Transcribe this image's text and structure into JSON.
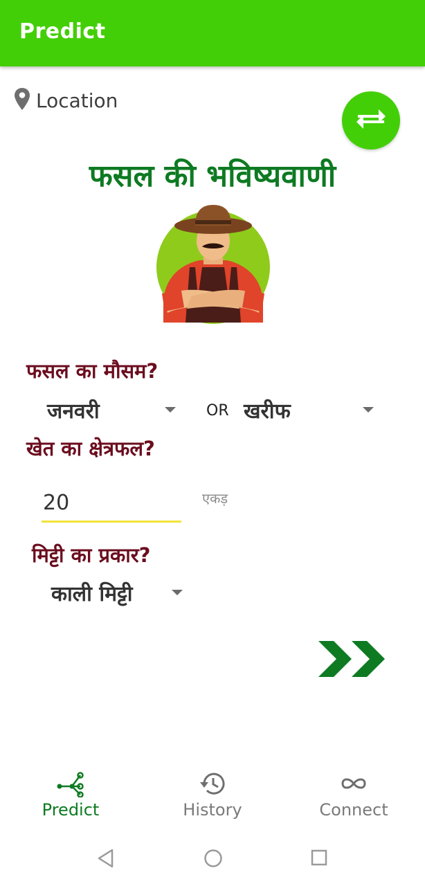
{
  "appbar": {
    "title": "Predict",
    "color": "#43cf07"
  },
  "location": {
    "label": "Location",
    "icon": "map-pin-icon"
  },
  "swap_button": {
    "icon": "swap-arrows-icon"
  },
  "page_title": "फसल की भविष्यवाणी",
  "illustration": {
    "name": "farmer-illustration"
  },
  "season": {
    "question": "फसल का मौसम?",
    "month_value": "जनवरी",
    "or_text": "OR",
    "season_value": "खरीफ"
  },
  "area": {
    "question": "खेत का क्षेत्रफल?",
    "value": "20",
    "unit": "एकड़"
  },
  "soil": {
    "question": "मिट्टी का प्रकार?",
    "value": "काली मिट्टी"
  },
  "next_button": {
    "icon": "double-chevron-right-icon",
    "color": "#0e7a22"
  },
  "bottom_nav": {
    "items": [
      {
        "label": "Predict",
        "icon": "share-nodes-icon",
        "active": true
      },
      {
        "label": "History",
        "icon": "history-icon",
        "active": false
      },
      {
        "label": "Connect",
        "icon": "infinity-icon",
        "active": false
      }
    ]
  },
  "system_nav": {
    "icons": [
      "back-icon",
      "home-icon",
      "recents-icon"
    ]
  }
}
